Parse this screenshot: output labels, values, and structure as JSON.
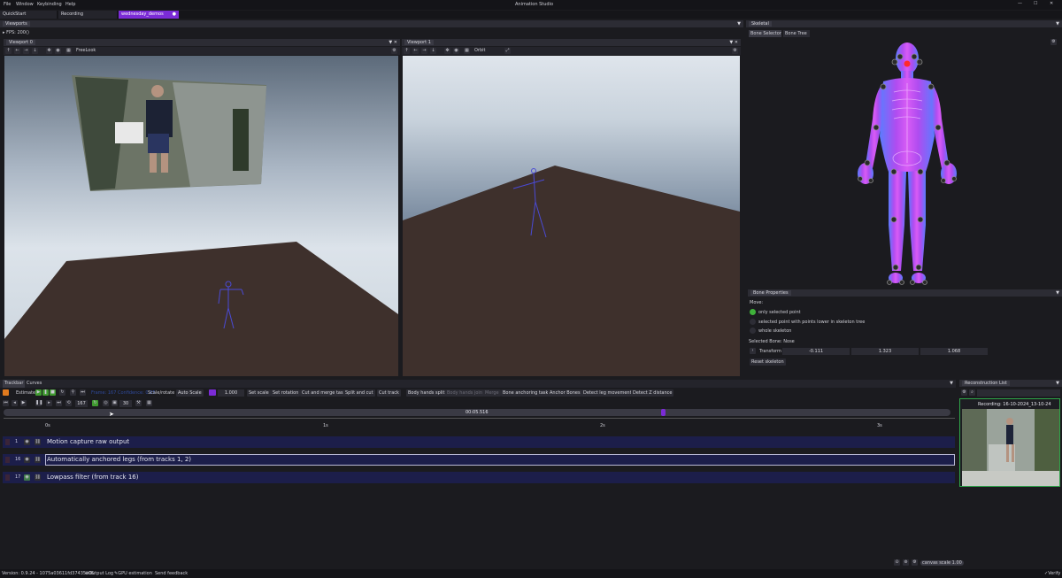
{
  "app": {
    "title": "Animation Studio",
    "menu": [
      "File",
      "Window",
      "Keybinding",
      "Help"
    ]
  },
  "doc_tabs": [
    "QuickStart",
    "Recording",
    "wednesday_demos"
  ],
  "viewports_panel": {
    "title": "Viewports",
    "fps": "FPS: 200()"
  },
  "viewport0": {
    "title": "Viewport 0",
    "mode": "FreeLook"
  },
  "viewport1": {
    "title": "Viewport 1",
    "mode": "Orbit"
  },
  "skeletal": {
    "title": "Skeletal",
    "tabs": [
      "Bone Selector",
      "Bone Tree"
    ]
  },
  "bone_properties": {
    "title": "Bone Properties",
    "move_label": "Move:",
    "options": [
      "only selected point",
      "selected point with points lower in skeleton tree",
      "whole skeleton"
    ],
    "selected_bone": "Selected Bone: Nose",
    "transform_label": "Transform",
    "transform_values": [
      "-0.111",
      "1.323",
      "1.068"
    ],
    "reset_label": "Reset skeleton"
  },
  "trackbar": {
    "tabs": [
      "Trackbar",
      "Curves"
    ],
    "estimate_label": "Estimate",
    "frame_text": "Frame: 167 Confidence: 0.85",
    "scale_rotate": "Scale/rotate",
    "auto_scale": "Auto Scale",
    "scale_value": "1.000",
    "buttons": [
      "Set scale",
      "Set rotation",
      "Cut and merge tasks",
      "Split and cut",
      "Cut track",
      "Body hands split",
      "Body hands join",
      "Merge",
      "Bone anchoring tasks",
      "Anchor Bones",
      "Detect leg movement",
      "Detect Z distance"
    ],
    "frame_current": "167",
    "frame_end": "30",
    "time_display": "00:05.516",
    "ruler": [
      "0s",
      "1s",
      "2s",
      "3s"
    ],
    "tracks": [
      {
        "num": "1",
        "name": "Motion capture raw output"
      },
      {
        "num": "16",
        "name": "Automatically anchored legs (from tracks 1, 2)"
      },
      {
        "num": "17",
        "name": "Lowpass filter (from track 16)"
      }
    ],
    "canvas_scale": "canvas scale 1.00"
  },
  "reconstruction": {
    "title": "Reconstruction List",
    "item_title": "Recording: 16-10-2024_13-10-24"
  },
  "status": {
    "version": "Version: 0.9.24 - 1075a03611fd37435c06",
    "output_log": "Output Log",
    "gpu": "GPU estimation",
    "feedback": "Send feedback",
    "right": "Verify"
  }
}
